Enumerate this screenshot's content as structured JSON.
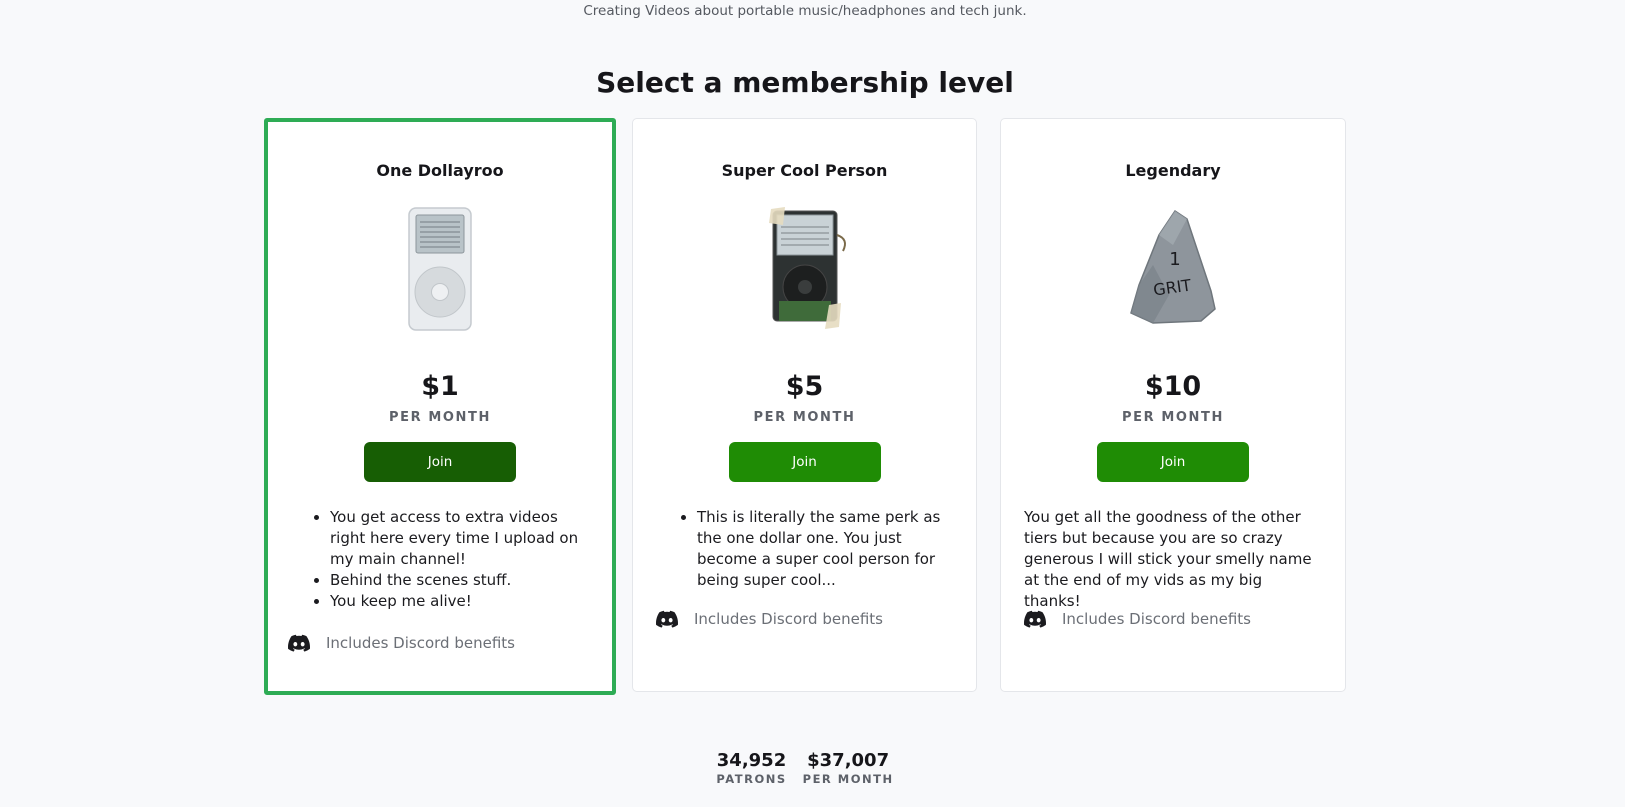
{
  "header": {
    "tagline": "Creating Videos about portable music/headphones and tech junk.",
    "title": "Select a membership level"
  },
  "tiers": [
    {
      "name": "One Dollayroo",
      "image_icon": "ipod-classic-icon",
      "price": "$1",
      "period": "PER MONTH",
      "join_label": "Join",
      "selected": true,
      "perks": [
        "You get access to extra videos right here every time I upload on my main channel!",
        "Behind the scenes stuff.",
        "You keep me alive!"
      ],
      "discord_label": "Includes Discord benefits"
    },
    {
      "name": "Super Cool Person",
      "image_icon": "disassembled-ipod-icon",
      "price": "$5",
      "period": "PER MONTH",
      "join_label": "Join",
      "selected": false,
      "perks": [
        "This is literally the same perk as the one dollar one. You just become a super cool person for being super cool..."
      ],
      "discord_label": "Includes Discord benefits"
    },
    {
      "name": "Legendary",
      "image_icon": "grit-rock-icon",
      "image_text": "1 GRIT",
      "price": "$10",
      "period": "PER MONTH",
      "join_label": "Join",
      "selected": false,
      "description": "You get all the goodness of the other tiers but because you are so crazy generous I will stick your smelly name at the end of my vids as my big thanks!",
      "discord_label": "Includes Discord benefits"
    }
  ],
  "stats": [
    {
      "value": "34,952",
      "label": "PATRONS"
    },
    {
      "value": "$37,007",
      "label": "PER MONTH"
    }
  ],
  "colors": {
    "selected_border": "#2eac55",
    "join_button": "#1f8c05",
    "join_button_selected": "#175e04",
    "page_background": "#f8f9fb"
  }
}
